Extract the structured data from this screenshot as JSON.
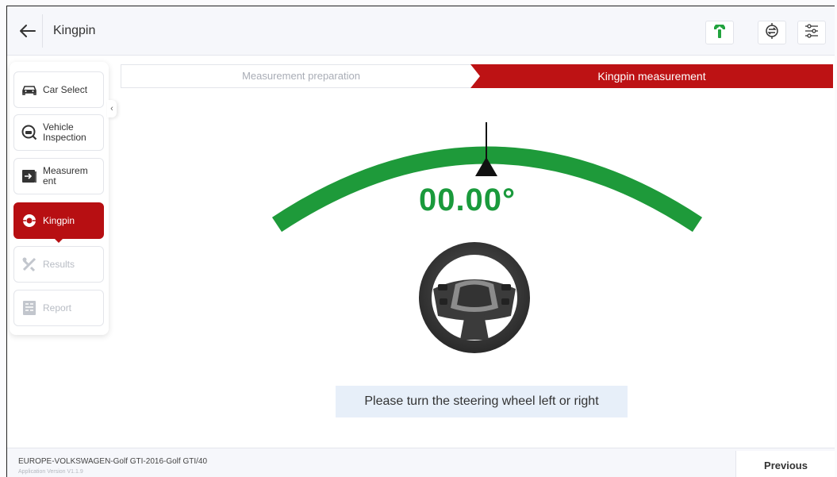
{
  "header": {
    "title": "Kingpin",
    "icons": [
      "back-arrow-icon",
      "wrench-icon",
      "sync-icon",
      "settings-sliders-icon"
    ]
  },
  "sidebar": {
    "items": [
      {
        "label": "Car Select",
        "icon": "car-icon",
        "state": "normal"
      },
      {
        "label": "Vehicle Inspection",
        "icon": "inspection-icon",
        "state": "normal"
      },
      {
        "label": "Measurement",
        "icon": "measurement-icon",
        "state": "normal"
      },
      {
        "label": "Kingpin",
        "icon": "kingpin-icon",
        "state": "active"
      },
      {
        "label": "Results",
        "icon": "results-icon",
        "state": "disabled"
      },
      {
        "label": "Report",
        "icon": "report-icon",
        "state": "disabled"
      }
    ],
    "labels": {
      "car_select": "Car Select",
      "vehicle_inspection_line1": "Vehicle",
      "vehicle_inspection_line2": "Inspection",
      "measurement_line1": "Measurem",
      "measurement_line2": "ent",
      "kingpin": "Kingpin",
      "results": "Results",
      "report": "Report"
    },
    "collapse_glyph": "‹"
  },
  "steps": [
    {
      "label": "Measurement preparation",
      "state": "done"
    },
    {
      "label": "Kingpin measurement",
      "state": "current"
    }
  ],
  "gauge": {
    "angle": "00.00°",
    "arc_color": "#1e9a3a",
    "value_color": "#1a9a3c"
  },
  "instruction": "Please turn the steering wheel left or right",
  "footer": {
    "vehicle_path": "EUROPE-VOLKSWAGEN-Golf GTI-2016-Golf GTI/40",
    "app_version": "Application Version V1.1.9",
    "previous_label": "Previous"
  },
  "colors": {
    "accent_red": "#bd1214",
    "active_nav": "#b70f12",
    "gauge_green": "#1e9a3a",
    "instruction_bg": "#e7eff9"
  }
}
